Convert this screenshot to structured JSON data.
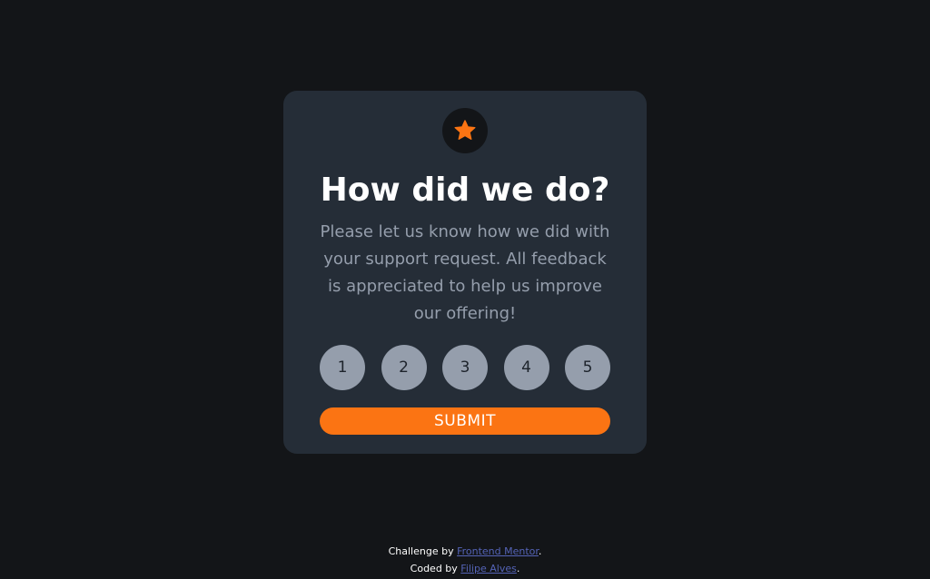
{
  "card": {
    "icon": "star-icon",
    "title": "How did we do?",
    "description": "Please let us know how we did with your support request. All feedback is appreciated to help us improve our offering!",
    "ratings": [
      "1",
      "2",
      "3",
      "4",
      "5"
    ],
    "submit_label": "SUBMIT"
  },
  "footer": {
    "challenge_prefix": "Challenge by ",
    "challenge_link": "Frontend Mentor",
    "challenge_suffix": ".",
    "coded_prefix": "Coded by ",
    "coded_link": "Filipe Alves",
    "coded_suffix": "."
  },
  "colors": {
    "background": "#131518",
    "card": "#252d37",
    "accent": "#fb7413",
    "muted": "#959eac",
    "link": "#5463b6"
  }
}
